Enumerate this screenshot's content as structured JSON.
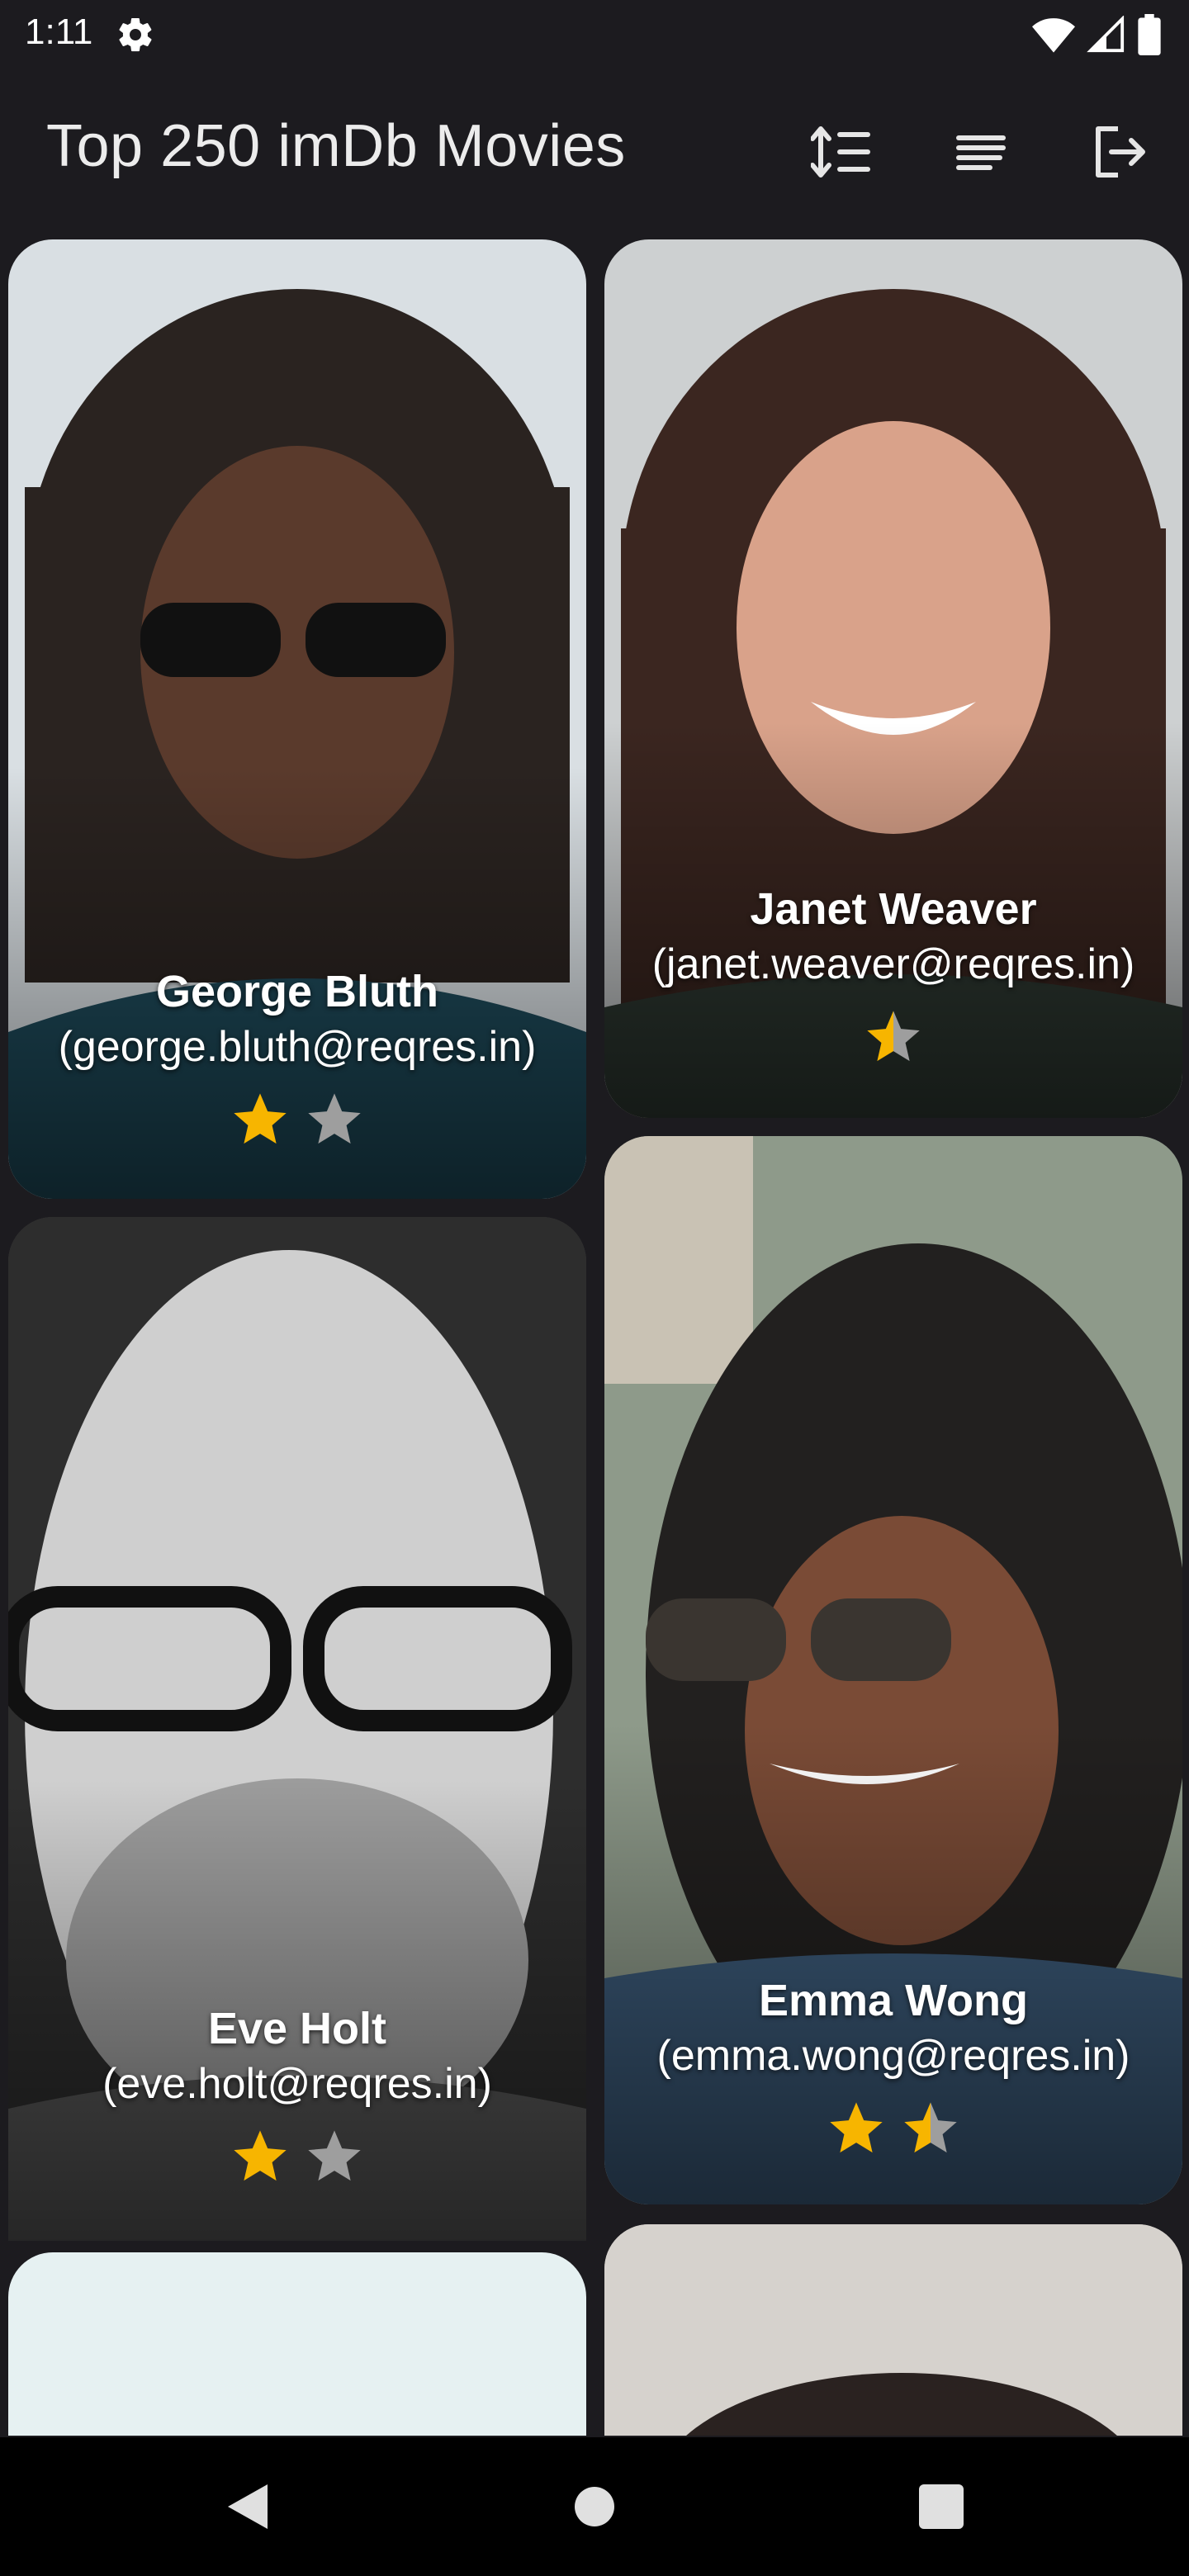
{
  "status_bar": {
    "time": "1:11"
  },
  "app_bar": {
    "title": "Top 250 imDb Movies",
    "actions": [
      "sort-icon",
      "filter-list-icon",
      "logout-icon"
    ]
  },
  "cards": [
    {
      "name": "George Bluth",
      "email": "(george.bluth@reqres.in)",
      "rating": 1,
      "max_rating": 2
    },
    {
      "name": "Janet Weaver",
      "email": "(janet.weaver@reqres.in)",
      "rating": 0.5,
      "max_rating": 1
    },
    {
      "name": "Eve Holt",
      "email": "(eve.holt@reqres.in)",
      "rating": 1,
      "max_rating": 2
    },
    {
      "name": "Emma Wong",
      "email": "(emma.wong@reqres.in)",
      "rating": 1.5,
      "max_rating": 2
    }
  ],
  "colors": {
    "background": "#1c1b1f",
    "star_filled": "#f7b500",
    "star_empty": "#9e9e9e"
  },
  "nav_bar": {
    "buttons": [
      "back-icon",
      "home-icon",
      "recents-icon"
    ]
  }
}
